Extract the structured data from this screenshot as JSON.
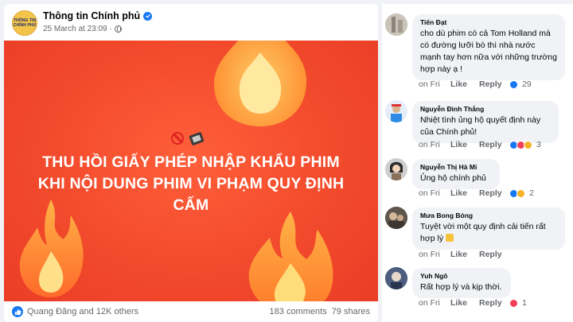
{
  "post": {
    "page_name": "Thông tin Chính phủ",
    "avatar_lines": [
      "THÔNG TIN",
      "CHÍNH PHỦ"
    ],
    "timestamp": "25 March at 23:09 ·",
    "headline_lines": [
      "THU HỒI GIẤY PHÉP NHẬP KHẨU PHIM",
      "KHI NỘI DUNG PHIM VI PHẠM QUY ĐỊNH",
      "CẤM"
    ],
    "reactions_text": "Quang Đăng and 12K others",
    "comments_count": "183 comments",
    "shares_count": "79 shares"
  },
  "colors": {
    "brand_blue": "#1877f2",
    "banner_red": "#f24a2c",
    "bubble_bg": "#f0f2f5"
  },
  "comments": [
    {
      "name": "Tiến Đạt",
      "text": "cho dù phim có cả Tom Holland mà có đường lưỡi bò thì nhà nước mạnh tay hơn nữa với những trường hợp này ạ !",
      "time": "on Fri",
      "like": "Like",
      "reply": "Reply",
      "reaction_count": "29",
      "reactions": [
        "like"
      ]
    },
    {
      "name": "Nguyễn Đình Thắng",
      "text": "Nhiệt tình ủng hộ quyết định này của Chính phủ!",
      "time": "on Fri",
      "like": "Like",
      "reply": "Reply",
      "reaction_count": "3",
      "reactions": [
        "like",
        "love",
        "care"
      ]
    },
    {
      "name": "Nguyễn Thị Hà Mi",
      "text": "Ủng hộ chính phủ",
      "time": "on Fri",
      "like": "Like",
      "reply": "Reply",
      "reaction_count": "2",
      "reactions": [
        "like",
        "haha"
      ]
    },
    {
      "name": "Mưa Bong Bóng",
      "text": "Tuyệt vời một quy định cải tiến rất hợp lý",
      "time": "on Fri",
      "like": "Like",
      "reply": "Reply",
      "reaction_count": "",
      "reactions": []
    },
    {
      "name": "Yuh Ngô",
      "text": "Rất hợp lý và kịp thời.",
      "time": "on Fri",
      "like": "Like",
      "reply": "Reply",
      "reaction_count": "1",
      "reactions": [
        "love"
      ]
    }
  ]
}
